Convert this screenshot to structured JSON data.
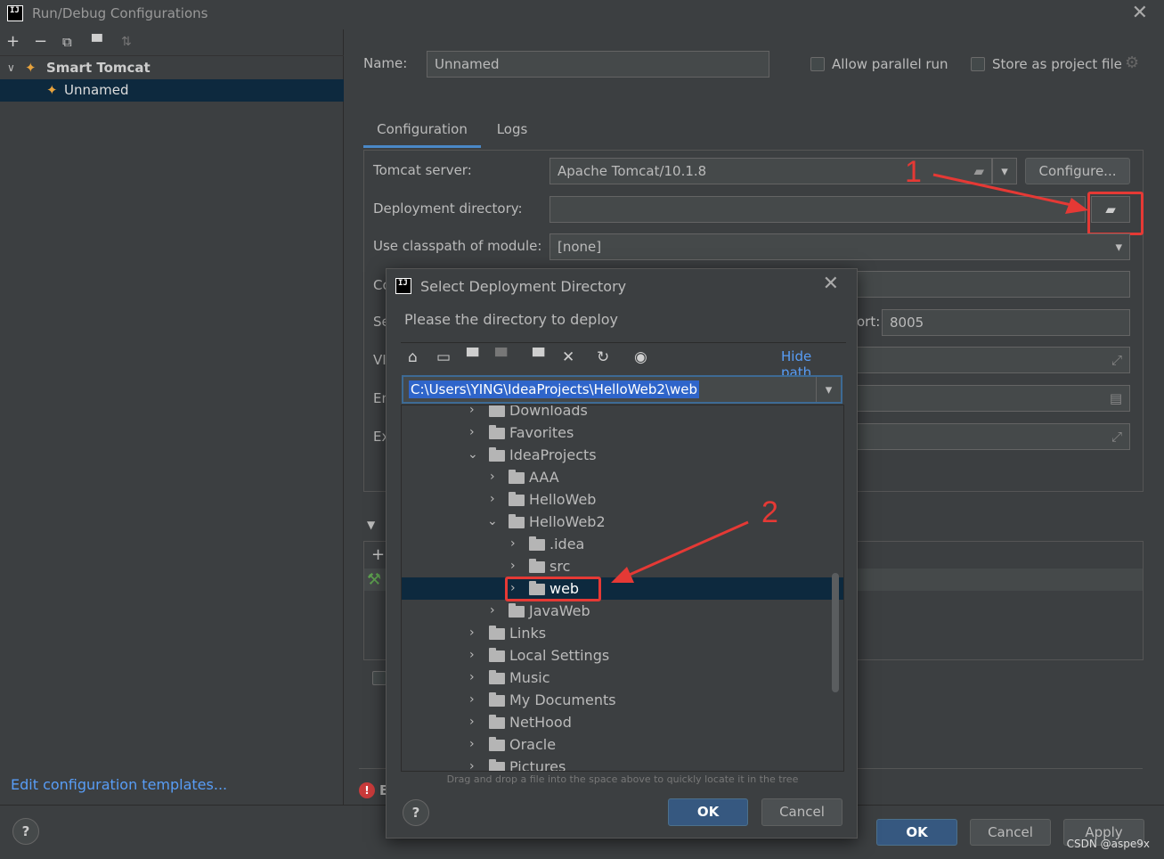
{
  "window": {
    "title": "Run/Debug Configurations",
    "app_icon": "IJ"
  },
  "left": {
    "toolbar_icons": [
      "plus-icon",
      "minus-icon",
      "copy-icon",
      "folder-add-icon",
      "sort-icon"
    ],
    "tree": [
      {
        "label": "Smart Tomcat",
        "expanded": true
      },
      {
        "label": "Unnamed",
        "selected": true
      }
    ],
    "edit_templates": "Edit configuration templates..."
  },
  "form": {
    "name_label": "Name:",
    "name_value": "Unnamed",
    "allow_parallel": "Allow parallel run",
    "store_project": "Store as project file",
    "tabs": [
      "Configuration",
      "Logs"
    ],
    "tomcat_server_label": "Tomcat server:",
    "tomcat_server_value": "Apache Tomcat/10.1.8",
    "configure_button": "Configure...",
    "deployment_label": "Deployment directory:",
    "deployment_value": "",
    "classpath_label": "Use classpath of module:",
    "classpath_value": "[none]",
    "row_co": "Co",
    "row_se": "Se",
    "port_label_partial": "ort:",
    "port_value": "8005",
    "row_vi": "VI",
    "row_en": "En",
    "row_ex": "Ex"
  },
  "footer": {
    "ok": "OK",
    "cancel": "Cancel",
    "apply": "Apply",
    "error_partial": "E"
  },
  "annotations": {
    "marker1": "1",
    "marker2": "2"
  },
  "dialog": {
    "title": "Select Deployment Directory",
    "subtitle": "Please the directory to deploy",
    "hide_path": "Hide path",
    "path": "C:\\Users\\YING\\IdeaProjects\\HelloWeb2\\web",
    "tree": [
      {
        "label": "Downloads",
        "level": 0,
        "expanded": false
      },
      {
        "label": "Favorites",
        "level": 0,
        "expanded": false
      },
      {
        "label": "IdeaProjects",
        "level": 0,
        "expanded": true
      },
      {
        "label": "AAA",
        "level": 1,
        "expanded": false
      },
      {
        "label": "HelloWeb",
        "level": 1,
        "expanded": false
      },
      {
        "label": "HelloWeb2",
        "level": 1,
        "expanded": true
      },
      {
        "label": ".idea",
        "level": 2,
        "expanded": false
      },
      {
        "label": "src",
        "level": 2,
        "expanded": false
      },
      {
        "label": "web",
        "level": 2,
        "expanded": false,
        "selected": true
      },
      {
        "label": "JavaWeb",
        "level": 1,
        "expanded": false
      },
      {
        "label": "Links",
        "level": 0,
        "expanded": false
      },
      {
        "label": "Local Settings",
        "level": 0,
        "expanded": false
      },
      {
        "label": "Music",
        "level": 0,
        "expanded": false
      },
      {
        "label": "My Documents",
        "level": 0,
        "expanded": false
      },
      {
        "label": "NetHood",
        "level": 0,
        "expanded": false
      },
      {
        "label": "Oracle",
        "level": 0,
        "expanded": false
      },
      {
        "label": "Pictures",
        "level": 0,
        "expanded": false
      }
    ],
    "drag_hint": "Drag and drop a file into the space above to quickly locate it in the tree",
    "ok": "OK",
    "cancel": "Cancel"
  },
  "watermark": "CSDN @aspe9x"
}
